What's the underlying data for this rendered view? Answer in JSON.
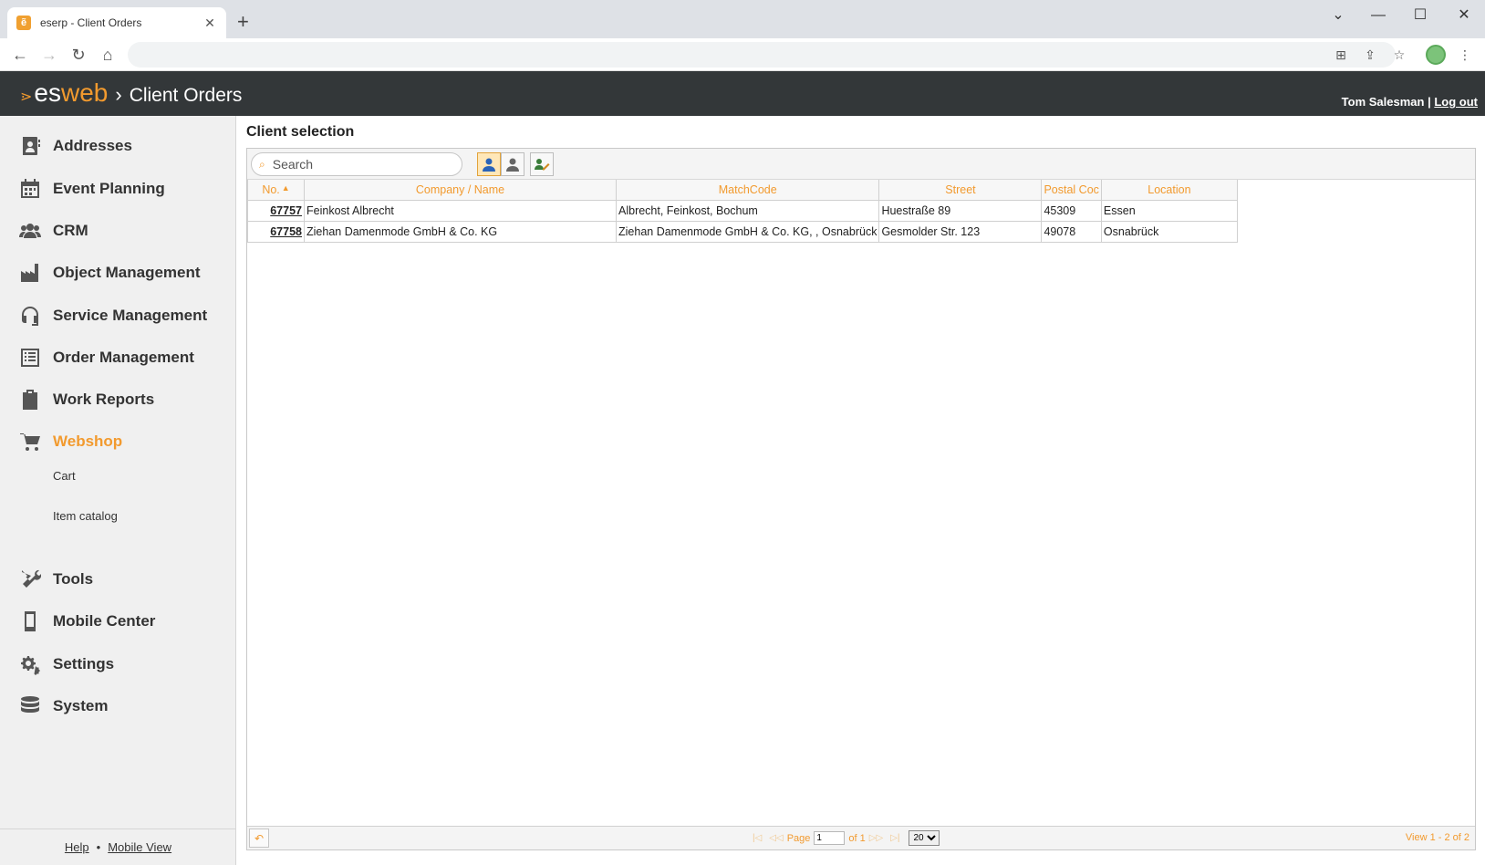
{
  "browser": {
    "tab_title": "eserp - Client Orders",
    "favicon_glyph": "ẽ",
    "new_tab": "+",
    "minimize": "⌄",
    "min": "—",
    "max": "☐",
    "close": "✕"
  },
  "header": {
    "logo_es": "es",
    "logo_web": "web",
    "separator": "›",
    "title": "Client Orders",
    "user_name": "Tom Salesman",
    "user_sep": " | ",
    "logout": "Log out"
  },
  "sidebar": {
    "items": [
      {
        "label": "Addresses",
        "icon": "address-book-icon"
      },
      {
        "label": "Event Planning",
        "icon": "calendar-icon"
      },
      {
        "label": "CRM",
        "icon": "users-icon"
      },
      {
        "label": "Object Management",
        "icon": "factory-icon"
      },
      {
        "label": "Service Management",
        "icon": "headset-icon"
      },
      {
        "label": "Order Management",
        "icon": "list-icon"
      },
      {
        "label": "Work Reports",
        "icon": "clipboard-icon"
      },
      {
        "label": "Webshop",
        "icon": "cart-icon"
      },
      {
        "label": "Tools",
        "icon": "tools-icon"
      },
      {
        "label": "Mobile Center",
        "icon": "mobile-icon"
      },
      {
        "label": "Settings",
        "icon": "gears-icon"
      },
      {
        "label": "System",
        "icon": "database-icon"
      }
    ],
    "subitems": [
      "Cart",
      "Item catalog"
    ],
    "footer": {
      "help": "Help",
      "dot": "•",
      "mobile_view": "Mobile View"
    }
  },
  "main": {
    "title": "Client selection",
    "search": {
      "placeholder": "Search",
      "value": ""
    },
    "columns": [
      "No.",
      "Company / Name",
      "MatchCode",
      "Street",
      "Postal Coc",
      "Location"
    ],
    "rows": [
      {
        "no": "67757",
        "company": "Feinkost Albrecht",
        "matchcode": "Albrecht, Feinkost, Bochum",
        "street": "Huestraße 89",
        "postal": "45309",
        "location": "Essen"
      },
      {
        "no": "67758",
        "company": "Ziehan Damenmode GmbH & Co. KG",
        "matchcode": "Ziehan Damenmode GmbH & Co. KG, , Osnabrück",
        "street": "Gesmolder Str. 123",
        "postal": "49078",
        "location": "Osnabrück"
      }
    ],
    "pager": {
      "first": "|◁",
      "prev": "◁◁",
      "page_label": "Page",
      "page_value": "1",
      "of_label": "of 1",
      "next": "▷▷",
      "last": "▷|",
      "page_size": "20",
      "view_info": "View 1 - 2 of 2"
    }
  },
  "colors": {
    "accent": "#f29a2e",
    "header_bg": "#333739",
    "sidebar_bg": "#f0f0f0"
  }
}
